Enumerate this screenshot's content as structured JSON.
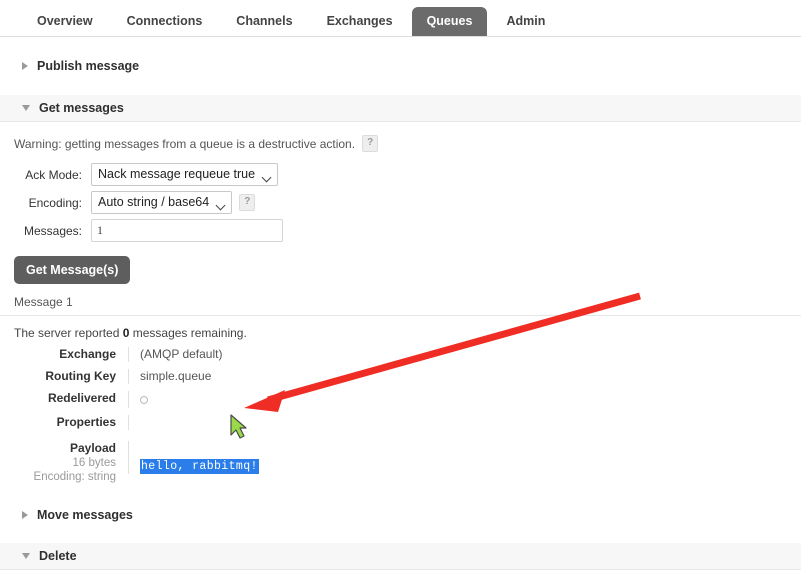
{
  "nav": {
    "tabs": [
      {
        "label": "Overview",
        "active": false
      },
      {
        "label": "Connections",
        "active": false
      },
      {
        "label": "Channels",
        "active": false
      },
      {
        "label": "Exchanges",
        "active": false
      },
      {
        "label": "Queues",
        "active": true
      },
      {
        "label": "Admin",
        "active": false
      }
    ]
  },
  "sections": {
    "publish_message": {
      "title": "Publish message",
      "expanded": false
    },
    "get_messages": {
      "title": "Get messages",
      "expanded": true
    },
    "move_messages": {
      "title": "Move messages",
      "expanded": false
    },
    "delete": {
      "title": "Delete",
      "expanded": true
    }
  },
  "get_messages": {
    "warning_text": "Warning: getting messages from a queue is a destructive action.",
    "warning_help": "?",
    "ack_mode_label": "Ack Mode:",
    "ack_mode_value": "Nack message requeue true",
    "encoding_label": "Encoding:",
    "encoding_value": "Auto string / base64",
    "encoding_help": "?",
    "messages_label": "Messages:",
    "messages_value": "1",
    "messages_placeholder": "",
    "get_button": "Get Message(s)"
  },
  "result": {
    "message_title": "Message 1",
    "server_prefix": "The server reported ",
    "server_count": "0",
    "server_suffix": " messages remaining.",
    "fields": [
      {
        "key": "Exchange",
        "value": "(AMQP default)"
      },
      {
        "key": "Routing Key",
        "value": "simple.queue"
      },
      {
        "key": "Redelivered",
        "value": ""
      }
    ],
    "properties_key": "Properties",
    "properties_value": "",
    "payload_key": "Payload",
    "payload_size": "16 bytes",
    "payload_encoding": "Encoding: string",
    "payload_value": "hello, rabbitmq!"
  },
  "annotations": {
    "arrow_color": "#ef2d24",
    "cursor_name": "mouse-cursor"
  },
  "colors": {
    "active_tab_bg": "#6b6b6b",
    "button_bg": "#5e5e5e",
    "selection_bg": "#2b7de9",
    "section_bg": "#f7f7f7"
  }
}
